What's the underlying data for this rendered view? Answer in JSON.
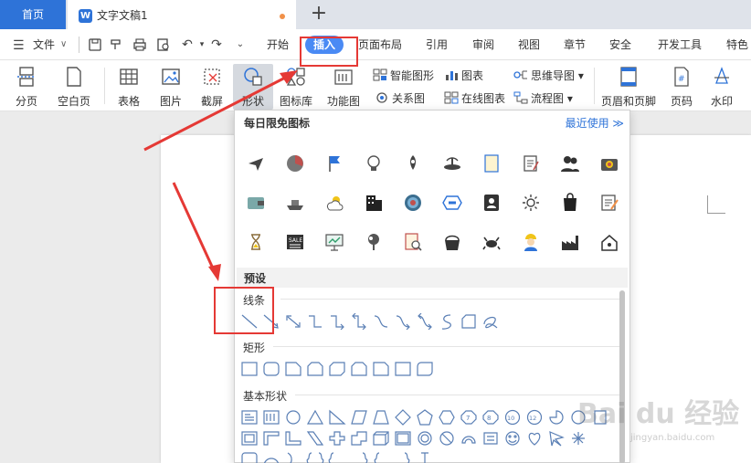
{
  "tabs": {
    "home": "首页",
    "doc": "文字文稿1",
    "add": "+"
  },
  "menu": {
    "file": "文件",
    "items": [
      "开始",
      "插入",
      "页面布局",
      "引用",
      "审阅",
      "视图",
      "章节",
      "安全",
      "开发工具",
      "特色"
    ],
    "active_index": 1
  },
  "ribbon": {
    "page_break": "分页",
    "blank_page": "空白页",
    "table": "表格",
    "picture": "图片",
    "screenshot": "截屏",
    "shape": "形状",
    "icon_lib": "图标库",
    "function_chart": "功能图",
    "smart_art": "智能图形",
    "chart": "图表",
    "mind_map": "思维导图",
    "relation": "关系图",
    "online_chart": "在线图表",
    "flowchart": "流程图",
    "header_footer": "页眉和页脚",
    "page_number": "页码",
    "watermark": "水印"
  },
  "panel": {
    "title": "每日限免图标",
    "recent": "最近使用",
    "preset": "预设",
    "categories": {
      "lines": "线条",
      "rect": "矩形",
      "basic": "基本形状"
    },
    "icon_names": [
      [
        "airplane-icon",
        "pie-chart-icon",
        "flag-icon",
        "lightbulb-icon",
        "rocket-icon",
        "fountain-icon",
        "book-icon",
        "notepad-icon",
        "users-icon",
        "camera-icon"
      ],
      [
        "wallet-icon",
        "ship-icon",
        "weather-icon",
        "building-icon",
        "target-icon",
        "hexagon-icon",
        "contact-card-icon",
        "sun-icon",
        "shopping-bag-icon",
        "edit-doc-icon"
      ],
      [
        "hourglass-icon",
        "sale-sign-icon",
        "presentation-icon",
        "tree-icon",
        "doc-search-icon",
        "basket-icon",
        "crab-icon",
        "worker-icon",
        "factory-icon",
        "house-icon"
      ]
    ]
  },
  "colors": {
    "accent": "#2e73d8",
    "highlight": "#e53935",
    "active_tab": "#4a8af4"
  },
  "watermark": {
    "text": "Bai du 经验",
    "url": "jingyan.baidu.com"
  }
}
